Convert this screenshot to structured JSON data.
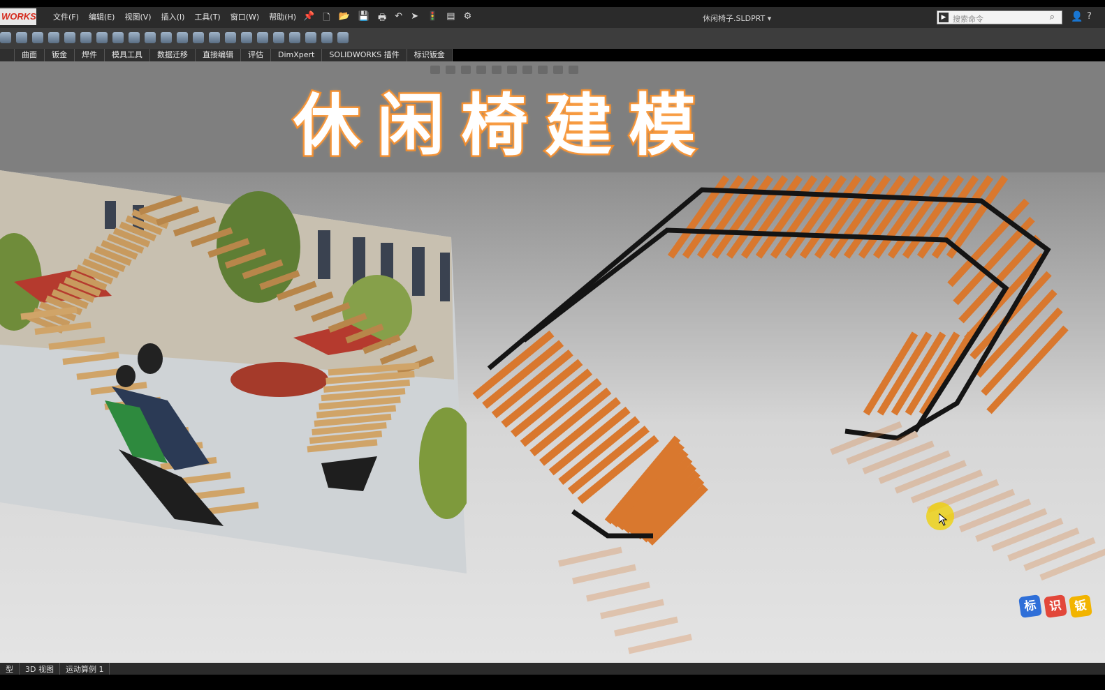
{
  "app": {
    "logo_text": "WORKS",
    "document_title": "休闲椅子.SLDPRT ▾"
  },
  "menu": [
    "文件(F)",
    "编辑(E)",
    "视图(V)",
    "插入(I)",
    "工具(T)",
    "窗口(W)",
    "帮助(H)"
  ],
  "search": {
    "placeholder": "搜索命令"
  },
  "tabs": [
    "",
    "曲面",
    "钣金",
    "焊件",
    "模具工具",
    "数据迁移",
    "直接编辑",
    "评估",
    "DimXpert",
    "SOLIDWORKS 插件",
    "标识钣金"
  ],
  "overlay_title": "休闲椅建模",
  "watermark": [
    "标",
    "识",
    "钣"
  ],
  "status_tabs": [
    "型",
    "3D 视图",
    "运动算例 1"
  ],
  "colors": {
    "accent": "#f08a2a",
    "wood": "#d9782e",
    "frame": "#1c1c1c"
  }
}
